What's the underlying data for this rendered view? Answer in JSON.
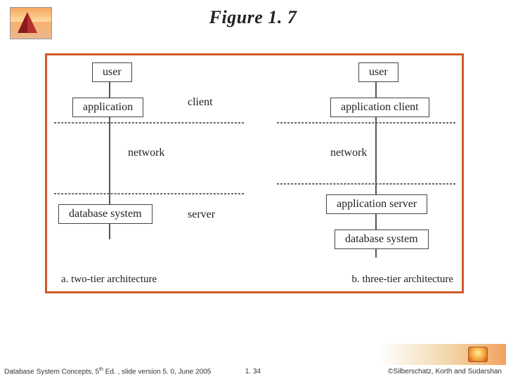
{
  "title": "Figure 1. 7",
  "diagram": {
    "left": {
      "boxes": {
        "user": "user",
        "application": "application",
        "dbsys": "database system"
      },
      "labels": {
        "client": "client",
        "server": "server",
        "network": "network"
      },
      "caption": "a.   two-tier architecture"
    },
    "right": {
      "boxes": {
        "user": "user",
        "appclient": "application client",
        "appserver": "application server",
        "dbsys": "database system"
      },
      "labels": {
        "network": "network"
      },
      "caption": "b.   three-tier architecture"
    }
  },
  "footer": {
    "left_prefix": "Database System Concepts, 5",
    "left_suffix": " Ed. , slide version 5. 0, June 2005",
    "middle": "1. 34",
    "right": "©Silberschatz, Korth and Sudarshan"
  }
}
